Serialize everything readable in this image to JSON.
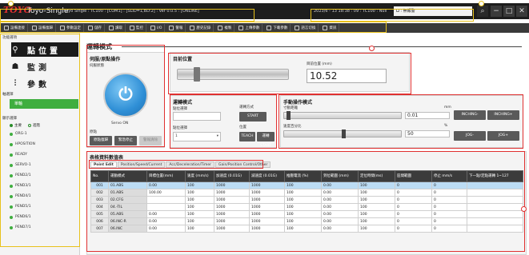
{
  "titlebar": {
    "logo": "TOYO",
    "app_title": "Toyo-Single",
    "connection": "Toyo Single : TC100 : [COM1] : [SLID=1,BD:2] : Ver 0.0.5 : [ONLINE]",
    "clock": "2023/6 - 13  18:38 : 09 : TC100 : Null",
    "alarm_box": "Ω : 無報警"
  },
  "toolbar": {
    "items": [
      {
        "icon": "connect-icon",
        "label": "設備連接"
      },
      {
        "icon": "reset-icon",
        "label": "設備復歸"
      },
      {
        "icon": "param-icon",
        "label": "參數設定"
      },
      {
        "icon": "save-icon",
        "label": "儲存"
      },
      {
        "icon": "read-icon",
        "label": "讀取"
      },
      {
        "icon": "monitor-icon",
        "label": "監控"
      },
      {
        "icon": "io-icon",
        "label": "I/O"
      },
      {
        "icon": "alarm-icon",
        "label": "警報"
      },
      {
        "icon": "history-icon",
        "label": "歷史記錄"
      },
      {
        "icon": "copy-icon",
        "label": "複製"
      },
      {
        "icon": "upload-icon",
        "label": "上傳參數"
      },
      {
        "icon": "download-icon",
        "label": "下載參數"
      },
      {
        "icon": "lang-icon",
        "label": "語言切換"
      },
      {
        "icon": "info-icon",
        "label": "資訊"
      }
    ]
  },
  "leftnav": {
    "header": "功能選項",
    "modes": [
      {
        "icon": "location-pin-icon",
        "label": "點位置",
        "active": true
      },
      {
        "icon": "monitor-person-icon",
        "label": "監測",
        "active": false
      },
      {
        "icon": "sliders-icon",
        "label": "參數",
        "active": false
      }
    ],
    "axis_section": "軸選擇",
    "axis_active": "單軸",
    "select_section": "顯示選擇",
    "radios": [
      {
        "label": "主要",
        "on": true
      },
      {
        "label": "進階",
        "on": false
      }
    ],
    "axes": [
      "ORG-1",
      "HPOSITION",
      "READY",
      "SERVO-1",
      "PEND2/1",
      "PEND3/1",
      "PEND4/1",
      "PEND5/1",
      "PEND6/1",
      "PEND7/1"
    ]
  },
  "main": {
    "title": "運轉模式",
    "servo_panel": {
      "label": "伺服/原點操作",
      "sub": "伺服狀態",
      "servo_state": "Servo ON",
      "origin_label": "原點",
      "btn_origin": "原點復歸",
      "btn_stop": "緊急停止",
      "btn_reset": "警報清除"
    },
    "position_panel": {
      "label": "目前位置",
      "value_label": "目前位置 (mm)",
      "value": "10.52",
      "bar_fraction": 0.15
    },
    "run_panel": {
      "label": "運轉模式",
      "pos_label": "點位選擇",
      "mode_label": "運轉方式",
      "start_label": "START",
      "speed_label": "位置",
      "point_label": "點位選擇",
      "point_value": "1",
      "teach": "TEACH",
      "restart": "運轉START"
    },
    "jog_panel": {
      "label": "手動操作模式",
      "move_label": "寸動距離",
      "move_unit": "mm",
      "move_value": "0.01",
      "speed_label": "速度百分比",
      "speed_unit": "%",
      "speed_value": "50",
      "move_fraction": 0.02,
      "speed_fraction": 0.5,
      "inching_minus": "INCHING-",
      "inching_plus": "INCHING+",
      "jog_minus": "JOG-",
      "jog_plus": "JOG+"
    },
    "table": {
      "title": "表格資料數值表",
      "tabs": [
        "Point Edit",
        "Position/Speed/Current",
        "Acc/Deceleration/Timer",
        "Gain/Position Control/Other"
      ],
      "columns": [
        "No.",
        "運動模式",
        "目標位置(mm)",
        "速度\n(mm/s)",
        "加速度\n(0.01G)",
        "減速度\n(0.01G)",
        "推壓電流\n(%)",
        "到位範圍\n(mm)",
        "定位時間(ms)",
        "區間範圍",
        "停止\nmm/s",
        "下一點/定點運轉\n1~127"
      ],
      "rows": [
        [
          "001",
          "01.ABS",
          "0.00",
          "100",
          "1000",
          "1000",
          "100",
          "0.00",
          "100",
          "0",
          "0"
        ],
        [
          "002",
          "01.ABS",
          "100.00",
          "100",
          "1000",
          "1000",
          "100",
          "0.00",
          "100",
          "0",
          "0"
        ],
        [
          "003",
          "02.CFG",
          "",
          "100",
          "1000",
          "1000",
          "100",
          "0.00",
          "100",
          "0",
          "0"
        ],
        [
          "004",
          "04.-TIL",
          "",
          "100",
          "1000",
          "1000",
          "100",
          "0.00",
          "100",
          "0",
          "0"
        ],
        [
          "005",
          "05.ABS",
          "0.00",
          "100",
          "1000",
          "1000",
          "100",
          "0.00",
          "100",
          "0",
          "0"
        ],
        [
          "006",
          "06.INC-R",
          "0.00",
          "100",
          "1000",
          "1000",
          "100",
          "0.00",
          "100",
          "0",
          "0"
        ],
        [
          "007",
          "06.INC",
          "0.00",
          "100",
          "1000",
          "1000",
          "100",
          "0.00",
          "100",
          "0",
          "0"
        ]
      ]
    }
  }
}
